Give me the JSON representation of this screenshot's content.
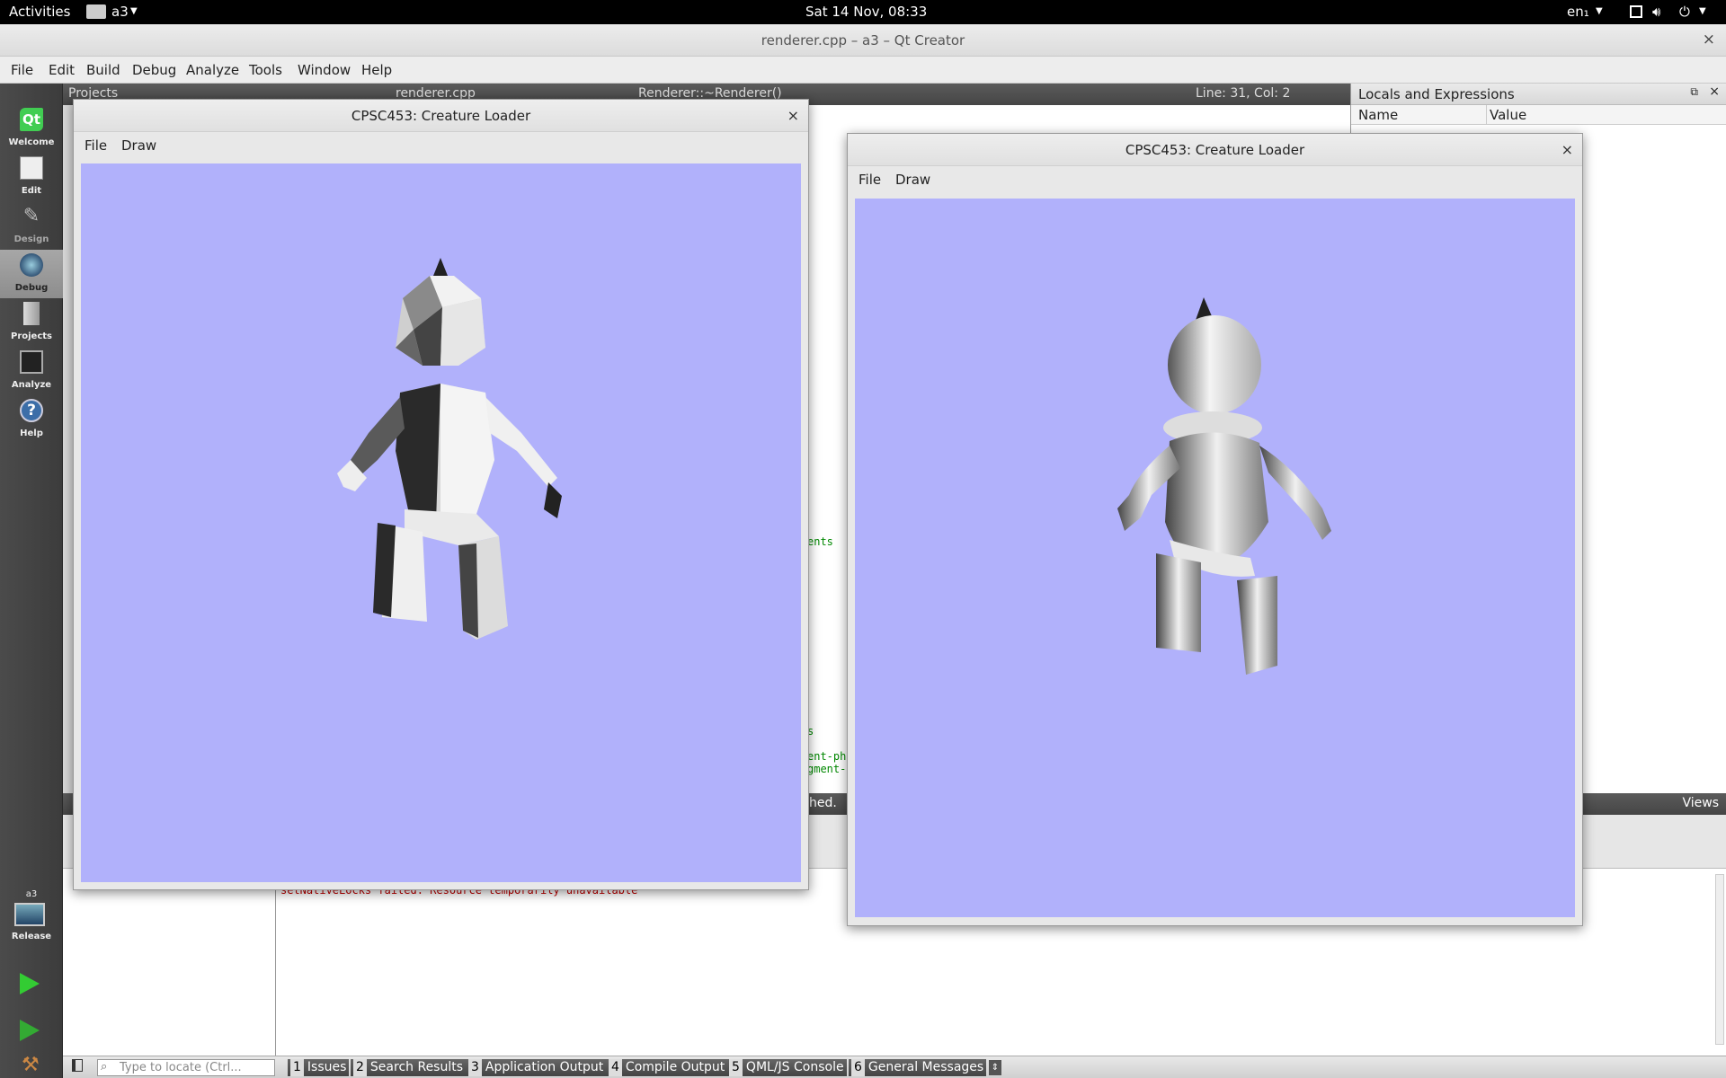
{
  "topbar": {
    "activities": "Activities",
    "app": "a3",
    "clock": "Sat 14 Nov, 08:33",
    "lang": "en₁"
  },
  "window": {
    "title": "renderer.cpp – a3 – Qt Creator"
  },
  "menu": [
    "File",
    "Edit",
    "Build",
    "Debug",
    "Analyze",
    "Tools",
    "Window",
    "Help"
  ],
  "modes": [
    "Welcome",
    "Edit",
    "Design",
    "Debug",
    "Projects",
    "Analyze",
    "Help"
  ],
  "kit": {
    "project": "a3",
    "config": "Release"
  },
  "editor_toolbar": {
    "projects": "Projects",
    "file": "renderer.cpp",
    "symbol": "Renderer::~Renderer()",
    "position": "Line: 31, Col: 2"
  },
  "locals": {
    "title": "Locals and Expressions",
    "col_name": "Name",
    "col_value": "Value",
    "views": "Views"
  },
  "editor_snippets": [
    "ents",
    "s",
    "ent-ph",
    "gment-",
    "hed."
  ],
  "output_text": "setNativeLocks failed: Resource temporarily unavailable",
  "locator_placeholder": "Type to locate (Ctrl...",
  "output_tabs": [
    {
      "num": "1",
      "label": "Issues"
    },
    {
      "num": "2",
      "label": "Search Results"
    },
    {
      "num": "3",
      "label": "Application Output"
    },
    {
      "num": "4",
      "label": "Compile Output"
    },
    {
      "num": "5",
      "label": "QML/JS Console"
    },
    {
      "num": "6",
      "label": "General Messages"
    }
  ],
  "creature_windows": [
    {
      "title": "CPSC453: Creature Loader",
      "menu_file": "File",
      "menu_draw": "Draw",
      "close": "×",
      "shading": "flat"
    },
    {
      "title": "CPSC453: Creature Loader",
      "menu_file": "File",
      "menu_draw": "Draw",
      "close": "×",
      "shading": "smooth"
    }
  ],
  "colors": {
    "canvas_bg": "#b1b1fb",
    "output_error": "#c00000"
  }
}
